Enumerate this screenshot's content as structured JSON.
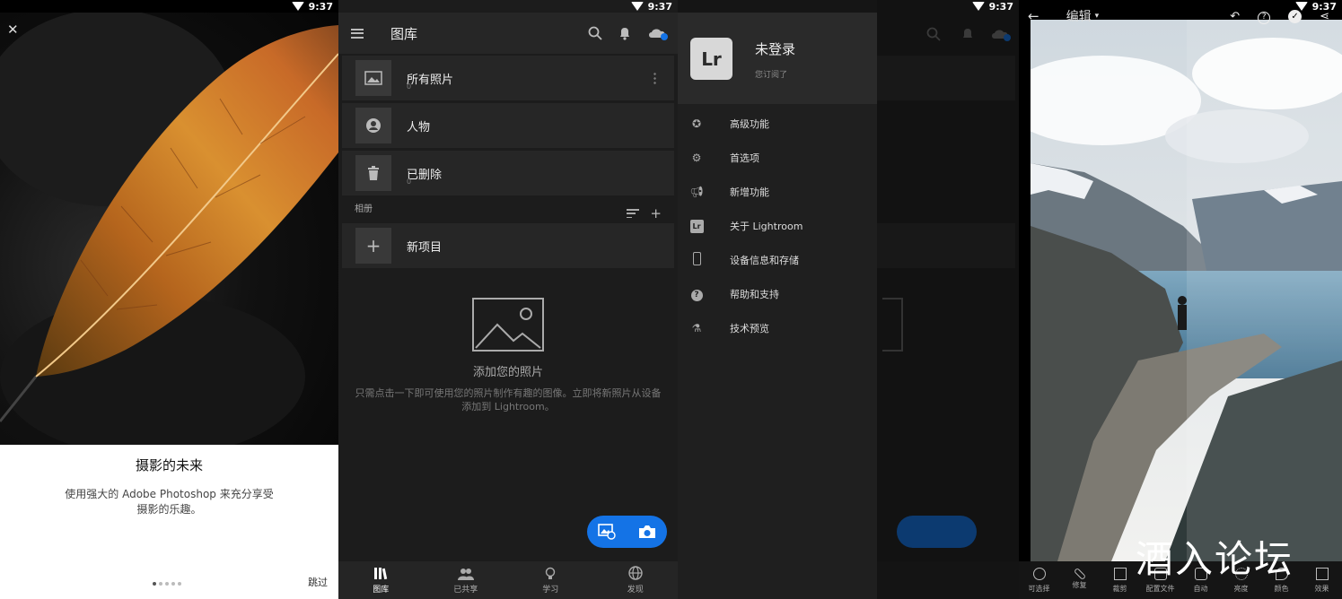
{
  "status": {
    "time": "9:37"
  },
  "onboarding": {
    "title": "摄影的未来",
    "description": "使用强大的 Adobe Photoshop 来充分享受摄影的乐趣。",
    "skip": "跳过"
  },
  "library": {
    "title": "图库",
    "items": [
      {
        "label": "所有照片",
        "count": "0"
      },
      {
        "label": "人物"
      },
      {
        "label": "已删除",
        "count": "0"
      }
    ],
    "albums_header": "相册",
    "new_item": "新项目",
    "empty_title": "添加您的照片",
    "empty_desc": "只需点击一下即可使用您的照片制作有趣的图像。立即将新照片从设备添加到 Lightroom。",
    "nav": [
      "图库",
      "已共享",
      "学习",
      "发现"
    ]
  },
  "drawer": {
    "logo": "Lr",
    "user": "未登录",
    "subtitle": "您订阅了",
    "items": [
      "高级功能",
      "首选项",
      "新增功能",
      "关于 Lightroom",
      "设备信息和存储",
      "帮助和支持",
      "技术预览"
    ]
  },
  "editor": {
    "title": "编辑",
    "tools": [
      "可选择",
      "修复",
      "裁剪",
      "配置文件",
      "自动",
      "亮度",
      "颜色",
      "效果"
    ],
    "watermark": "酒入论坛"
  },
  "colors": {
    "accent": "#1473e6"
  }
}
